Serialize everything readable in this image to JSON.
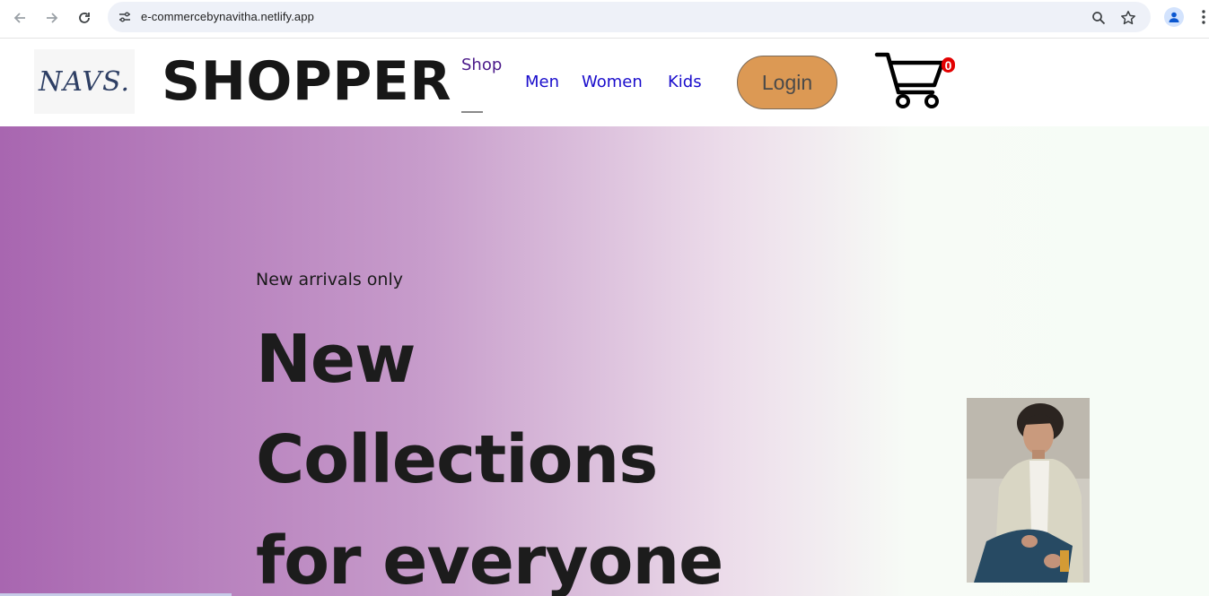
{
  "browser": {
    "url": "e-commercebynavitha.netlify.app",
    "icons": [
      "back-arrow-icon",
      "forward-arrow-icon",
      "reload-icon",
      "site-settings-icon",
      "zoom-icon",
      "bookmark-star-icon",
      "profile-icon",
      "menu-dots-icon"
    ]
  },
  "header": {
    "logo_text": "NAVS.",
    "brand": "SHOPPER",
    "menu": {
      "shop": "Shop",
      "men": "Men",
      "women": "Women",
      "kids": "Kids"
    },
    "login_label": "Login",
    "cart_count": "0",
    "colors": {
      "menu_link": "#1a0dcc",
      "active_menu": "#4b1a8a",
      "login_bg": "#dc9954",
      "cart_badge": "#e30000"
    }
  },
  "hero": {
    "kicker": "New arrivals only",
    "line1": "New",
    "line2": "Collections",
    "line3": "for everyone",
    "colors": {
      "gradient_start": "#a866b0",
      "gradient_end": "#f6fcf6"
    }
  }
}
